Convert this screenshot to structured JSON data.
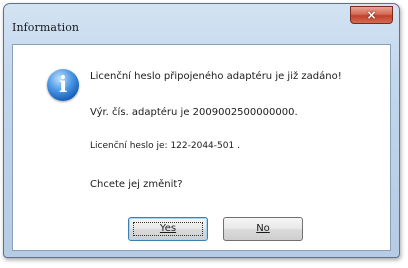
{
  "window": {
    "title": "Information",
    "close_glyph": "×"
  },
  "dialog": {
    "icon": "info-icon",
    "icon_glyph": "i",
    "message_line1": "Licenční heslo připojeného adaptéru je již zadáno!",
    "message_line2": "Výr. čís. adaptéru je 2009002500000000.",
    "message_line3": "Licenční heslo je:  122-2044-501 .",
    "message_line4": "Chcete jej změnit?"
  },
  "buttons": {
    "yes_label": "Yes",
    "no_label": "No"
  },
  "colors": {
    "close_button": "#c0412c",
    "info_icon": "#1660bb"
  }
}
